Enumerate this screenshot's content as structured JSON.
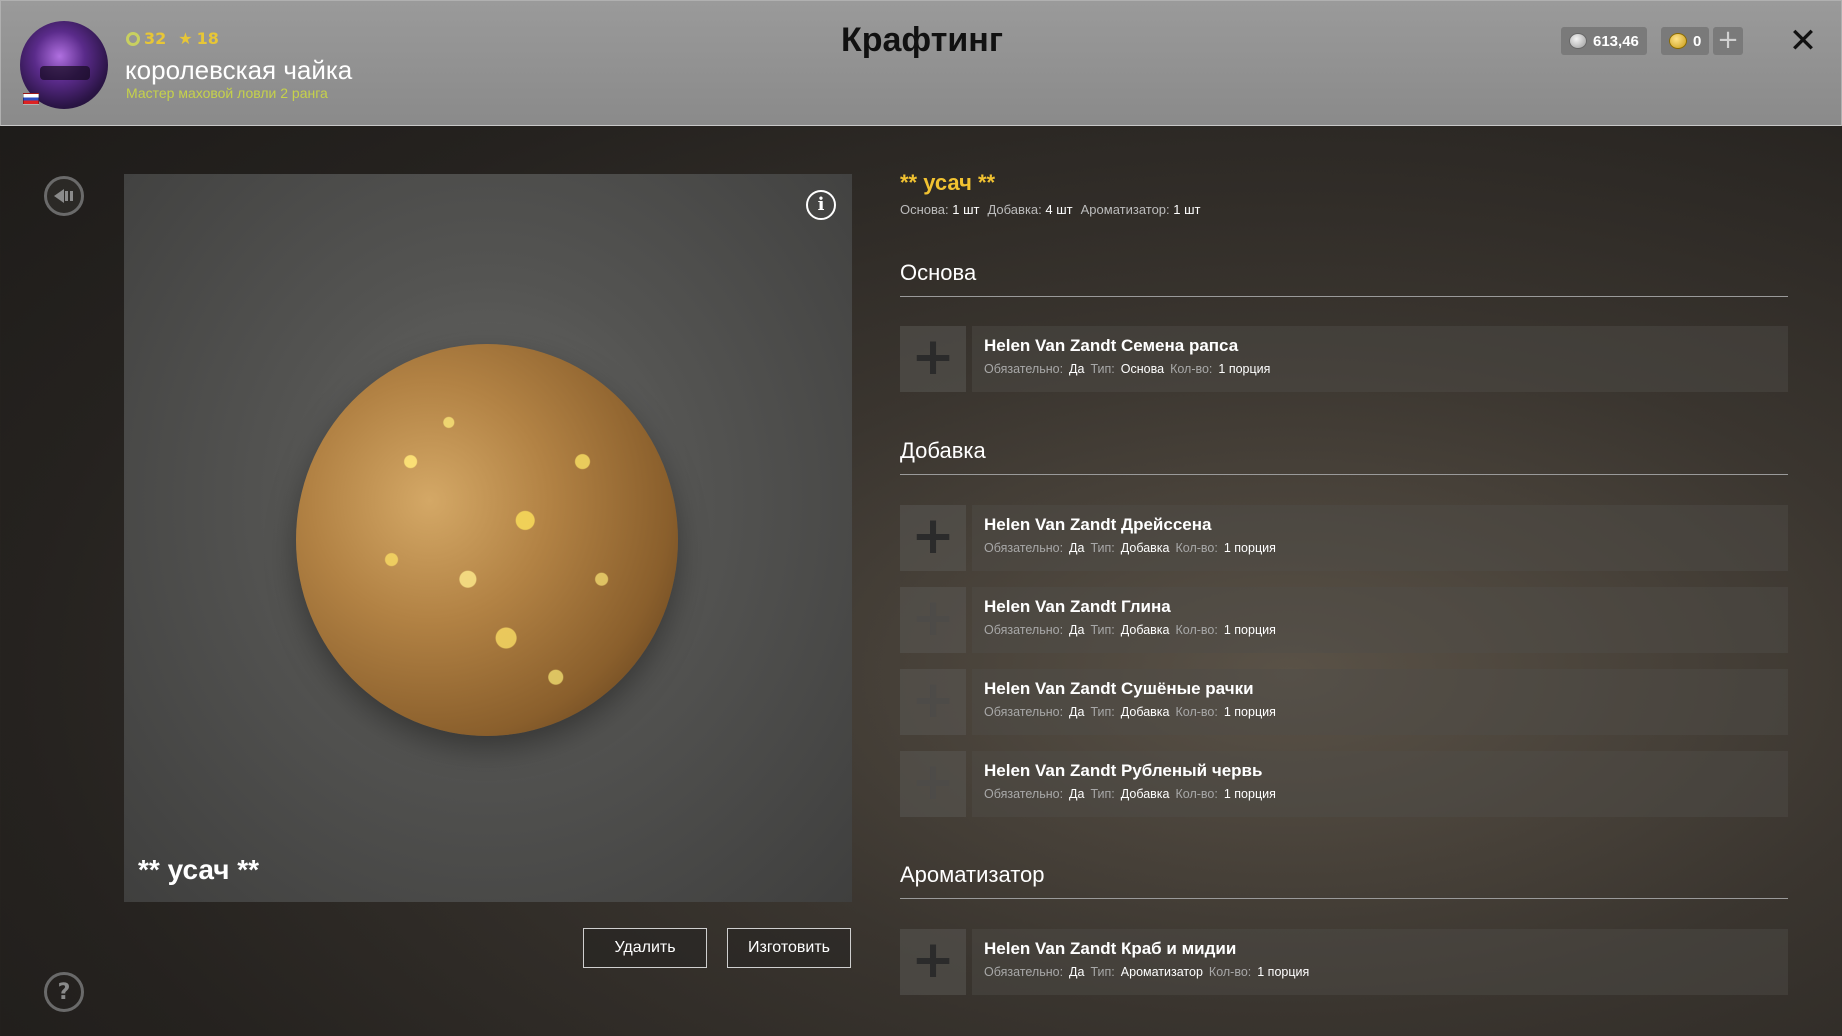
{
  "header": {
    "title": "Крафтинг",
    "player": {
      "level": "32",
      "stars": "18",
      "name": "королевская чайка",
      "rank": "Мастер маховой ловли 2 ранга"
    },
    "silver": "613,46",
    "gold": "0",
    "plus_label": "+",
    "close_label": "✕"
  },
  "preview": {
    "info_label": "i",
    "name": "** усач **"
  },
  "buttons": {
    "delete": "Удалить",
    "craft": "Изготовить"
  },
  "recipe": {
    "title": "** усач **",
    "summary": [
      {
        "label": "Основа:",
        "value": "1 шт"
      },
      {
        "label": "Добавка:",
        "value": "4 шт"
      },
      {
        "label": "Ароматизатор:",
        "value": "1 шт"
      }
    ]
  },
  "labels": {
    "required": "Обязательно:",
    "type": "Тип:",
    "qty": "Кол-во:"
  },
  "sections": [
    {
      "title": "Основа",
      "slots": [
        {
          "name": "Helen Van Zandt Семена рапса",
          "required": "Да",
          "type": "Основа",
          "qty": "1 порция"
        }
      ]
    },
    {
      "title": "Добавка",
      "slots": [
        {
          "name": "Helen Van Zandt Дрейссена",
          "required": "Да",
          "type": "Добавка",
          "qty": "1 порция"
        },
        {
          "name": "Helen Van Zandt Глина",
          "required": "Да",
          "type": "Добавка",
          "qty": "1 порция"
        },
        {
          "name": "Helen Van Zandt Сушёные рачки",
          "required": "Да",
          "type": "Добавка",
          "qty": "1 порция"
        },
        {
          "name": "Helen Van Zandt Рубленый червь",
          "required": "Да",
          "type": "Добавка",
          "qty": "1 порция"
        }
      ]
    },
    {
      "title": "Ароматизатор",
      "slots": [
        {
          "name": "Helen Van Zandt Краб и мидии",
          "required": "Да",
          "type": "Ароматизатор",
          "qty": "1 порция"
        }
      ]
    }
  ],
  "icons": {
    "back": "back-icon",
    "help": "help-icon",
    "info": "info-icon",
    "add": "plus-icon"
  },
  "colors": {
    "accent_gold": "#f1c231",
    "rank_green": "#c6d24a"
  }
}
